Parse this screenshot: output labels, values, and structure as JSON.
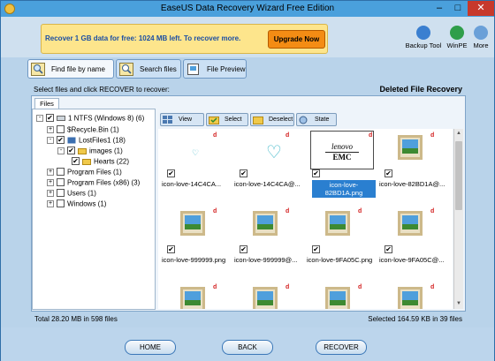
{
  "window": {
    "title": "EaseUS Data Recovery Wizard Free Edition"
  },
  "banner": {
    "promo_text": "Recover 1 GB data for free: 1024 MB left. To recover more.",
    "upgrade_label": "Upgrade Now",
    "tools": [
      {
        "label": "Backup Tool",
        "icon": "backup-tool-icon",
        "color": "#3a7fd0"
      },
      {
        "label": "WinPE",
        "icon": "winpe-icon",
        "color": "#2f9e4a"
      },
      {
        "label": "More",
        "icon": "more-icon",
        "color": "#6aa0d8"
      }
    ]
  },
  "tabs": [
    {
      "label": "Find file by name",
      "icon": "magnifier-icon"
    },
    {
      "label": "Search files",
      "icon": "search-files-icon"
    },
    {
      "label": "File Preview",
      "icon": "file-preview-icon"
    }
  ],
  "hint": "Select files and click RECOVER to recover:",
  "section_title": "Deleted File Recovery",
  "files_tab": "Files",
  "tree": [
    {
      "label": "1 NTFS (Windows 8) (6)",
      "expander": "-",
      "check": "✔"
    },
    {
      "label": "$Recycle.Bin (1)",
      "expander": "+",
      "check": ""
    },
    {
      "label": "LostFiles1 (18)",
      "expander": "-",
      "check": "✔"
    },
    {
      "label": "images (1)",
      "expander": "-",
      "check": "✔"
    },
    {
      "label": "Hearts (22)",
      "expander": "",
      "check": "✔"
    },
    {
      "label": "Program Files (1)",
      "expander": "+",
      "check": ""
    },
    {
      "label": "Program Files (x86) (3)",
      "expander": "+",
      "check": ""
    },
    {
      "label": "Users (1)",
      "expander": "+",
      "check": ""
    },
    {
      "label": "Windows (1)",
      "expander": "+",
      "check": ""
    }
  ],
  "toolbar": {
    "view": "View",
    "select": "Select",
    "deselect": "Deselect",
    "state": "State"
  },
  "files": [
    {
      "name": "icon-love-14C4CA...",
      "thumb": "heart-small",
      "checked": true
    },
    {
      "name": "icon-love-14C4CA@...",
      "thumb": "heart-big",
      "checked": true
    },
    {
      "name": "icon-love-82BD1A.png",
      "thumb": "lenovo",
      "checked": true,
      "selected": true,
      "lenovo_top": "lenovo",
      "lenovo_bottom": "EMC"
    },
    {
      "name": "icon-love-82BD1A@...",
      "thumb": "image",
      "checked": true
    },
    {
      "name": "icon-love-999999.png",
      "thumb": "image",
      "checked": true
    },
    {
      "name": "icon-love-999999@...",
      "thumb": "image",
      "checked": true
    },
    {
      "name": "icon-love-9FA05C.png",
      "thumb": "image",
      "checked": true
    },
    {
      "name": "icon-love-9FA05C@...",
      "thumb": "image",
      "checked": true
    },
    {
      "name": "",
      "thumb": "image",
      "checked": false
    },
    {
      "name": "",
      "thumb": "image",
      "checked": false
    },
    {
      "name": "",
      "thumb": "image",
      "checked": false
    },
    {
      "name": "",
      "thumb": "image",
      "checked": false
    }
  ],
  "deleted_marker": "d",
  "status": {
    "left": "Total 28.20 MB in 598 files",
    "right": "Selected 164.59 KB in 39 files"
  },
  "nav": {
    "home": "HOME",
    "back": "BACK",
    "recover": "RECOVER"
  }
}
